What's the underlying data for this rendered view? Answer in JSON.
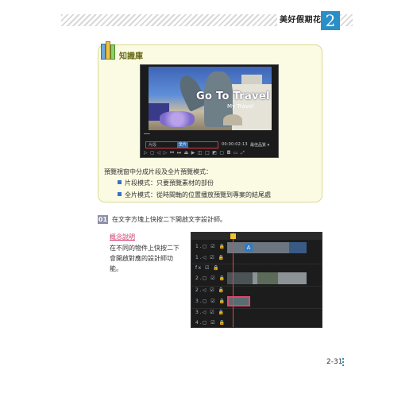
{
  "header": {
    "chapter_title": "美好假期花絮",
    "chapter_number": "2"
  },
  "knowledge": {
    "title": "知識庫",
    "preview": {
      "overlay_title": "Go To Travel",
      "overlay_subtitle": "My Travel",
      "mode_clip": "片段",
      "mode_full": "全片",
      "timecode": "00:00:02:13",
      "quality": "最佳品質 ▾"
    },
    "desc": "預覽視窗中分成片段及全片預覽模式：",
    "bullets": [
      "片段模式：只要預覽素材的部份",
      "全片模式：從時間軸的位置播放預覽到專案的結尾處"
    ]
  },
  "step": {
    "number": "01",
    "text": "在文字方塊上快按二下開啟文字設計師。"
  },
  "concept": {
    "label": "概念說明",
    "text": "在不同的物件上快按二下會開啟對應的設計師功能。"
  },
  "timeline": {
    "tracks": [
      "1.▢ ☑ 🔒",
      "1.◁ ☑ 🔒",
      "fx ☑ 🔒",
      "2.▢ ☑ 🔒",
      "2.◁ ☑ 🔒",
      "3.▢ ☑ 🔒",
      "3.◁ ☑ 🔒",
      "4.▢ ☑ 🔒"
    ],
    "clip_a_letter": "A"
  },
  "footer": {
    "page_number": "2-31"
  }
}
